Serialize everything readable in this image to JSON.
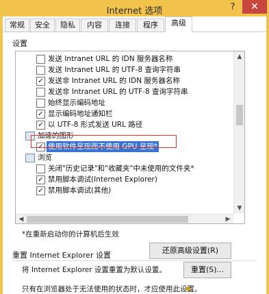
{
  "window": {
    "title": "Internet 选项",
    "help": "?",
    "close": "✕"
  },
  "tabs": [
    {
      "label": "常规"
    },
    {
      "label": "安全"
    },
    {
      "label": "隐私"
    },
    {
      "label": "内容"
    },
    {
      "label": "连接"
    },
    {
      "label": "程序"
    },
    {
      "label": "高级",
      "active": true
    }
  ],
  "settings": {
    "label": "设置",
    "items": [
      {
        "text": "发送 Intranet URL 的 IDN 服务器名称",
        "checked": false
      },
      {
        "text": "发送 Intranet URL 的 UTF-8 查询字符串",
        "checked": false
      },
      {
        "text": "发送非 Intranet URL 的 IDN 服务器名称",
        "checked": true
      },
      {
        "text": "发送非 Intranet URL 的 UTF-8 查询字符串",
        "checked": false
      },
      {
        "text": "始终显示编码地址",
        "checked": false
      },
      {
        "text": "显示编码地址通知栏",
        "checked": true
      },
      {
        "text": "以 UTF-8 形式发送 URL 路径",
        "checked": true
      },
      {
        "text": "加速的图形",
        "category": true
      },
      {
        "text": "使用软件呈现而不使用 GPU 呈现*",
        "checked": true,
        "highlighted": true
      },
      {
        "text": "浏览",
        "category": true
      },
      {
        "text": "关闭\"历史记录\"和\"收藏夹\"中未使用的文件夹*",
        "checked": false
      },
      {
        "text": "禁用脚本调试(Internet Explorer)",
        "checked": true
      },
      {
        "text": "禁用脚本调试(其他)",
        "checked": true
      }
    ],
    "note": "*在重新启动你的计算机后生效",
    "restore_button": "还原高级设置(R)"
  },
  "reset": {
    "title": "重置 Internet Explorer 设置",
    "desc": "将 Internet Explorer 设置重置为默认设置。",
    "button": "重置(S)...",
    "warning": "只有在浏览器处于无法使用的状态时，才应使用此设置。"
  },
  "colors": {
    "titlebar": "#f2c34b",
    "close": "#c7463f",
    "selection": "#3b73d0",
    "highlight_box": "#e0302b"
  }
}
